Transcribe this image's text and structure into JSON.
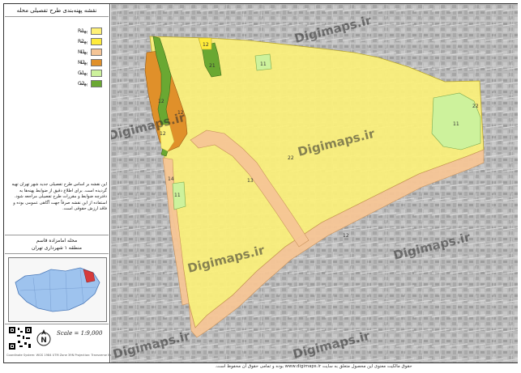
{
  "title": "نقشه پهنه‌بندی طرح تفصیلی محله",
  "legend": [
    {
      "code": "R1",
      "label": "پهنه",
      "color": "#fff176"
    },
    {
      "code": "R2",
      "label": "پهنه",
      "color": "#ffeb3b"
    },
    {
      "code": "M1",
      "label": "پهنه",
      "color": "#f5c596"
    },
    {
      "code": "M2",
      "label": "پهنه",
      "color": "#e0902a"
    },
    {
      "code": "G1",
      "label": "پهنه",
      "color": "#cdf29c"
    },
    {
      "code": "G2",
      "label": "پهنه",
      "color": "#6aa832"
    }
  ],
  "description": "این نقشه بر اساس طرح تفصیلی جدید شهر تهران تهیه گردیده است. برای اطلاع دقیق از ضوابط پهنه‌ها به دفترچه ضوابط و مقررات طرح تفصیلی مراجعه شود. استفاده از این نقشه صرفاً جهت آگاهی عمومی بوده و فاقد ارزش حقوقی است.",
  "district": {
    "neighborhood": "محله امامزاده قاسم",
    "region": "منطقه ۱ شهرداری تهران"
  },
  "scale": "Scale = 1:9,000",
  "north_label": "N",
  "small_credit": "Coordinate System: WGS 1984 UTM Zone 39N   Projection: Transverse Mercator",
  "footer": "حقوق مالکیت معنوی این محصول متعلق به سایت www.digimaps.ir بوده و تمامی حقوق آن محفوظ است.",
  "watermark": "Digimaps.ir",
  "zones": [
    {
      "id": "zone-main",
      "code": "22"
    },
    {
      "id": "zone-m-west-1",
      "code": "12"
    },
    {
      "id": "zone-m-west-2",
      "code": "12"
    },
    {
      "id": "zone-m-west-3",
      "code": "12"
    },
    {
      "id": "zone-m-south",
      "code": "12"
    },
    {
      "id": "zone-m-corridor",
      "code": "13"
    },
    {
      "id": "zone-m-west-strip",
      "code": "14"
    },
    {
      "id": "zone-g-west",
      "code": "11"
    },
    {
      "id": "zone-g-north",
      "code": "11"
    },
    {
      "id": "zone-g-east",
      "code": "11"
    },
    {
      "id": "zone-g2-north",
      "code": "21"
    },
    {
      "id": "zone-r2-north",
      "code": "12"
    },
    {
      "id": "zone-east-label",
      "code": "22"
    }
  ],
  "colors": {
    "residential": "#fbf07a",
    "mixed": "#f5c596",
    "mixed_dark": "#e0902a",
    "green_light": "#cdf29c",
    "green_dark": "#6aa832",
    "city_bg": "#b7b7b7"
  }
}
